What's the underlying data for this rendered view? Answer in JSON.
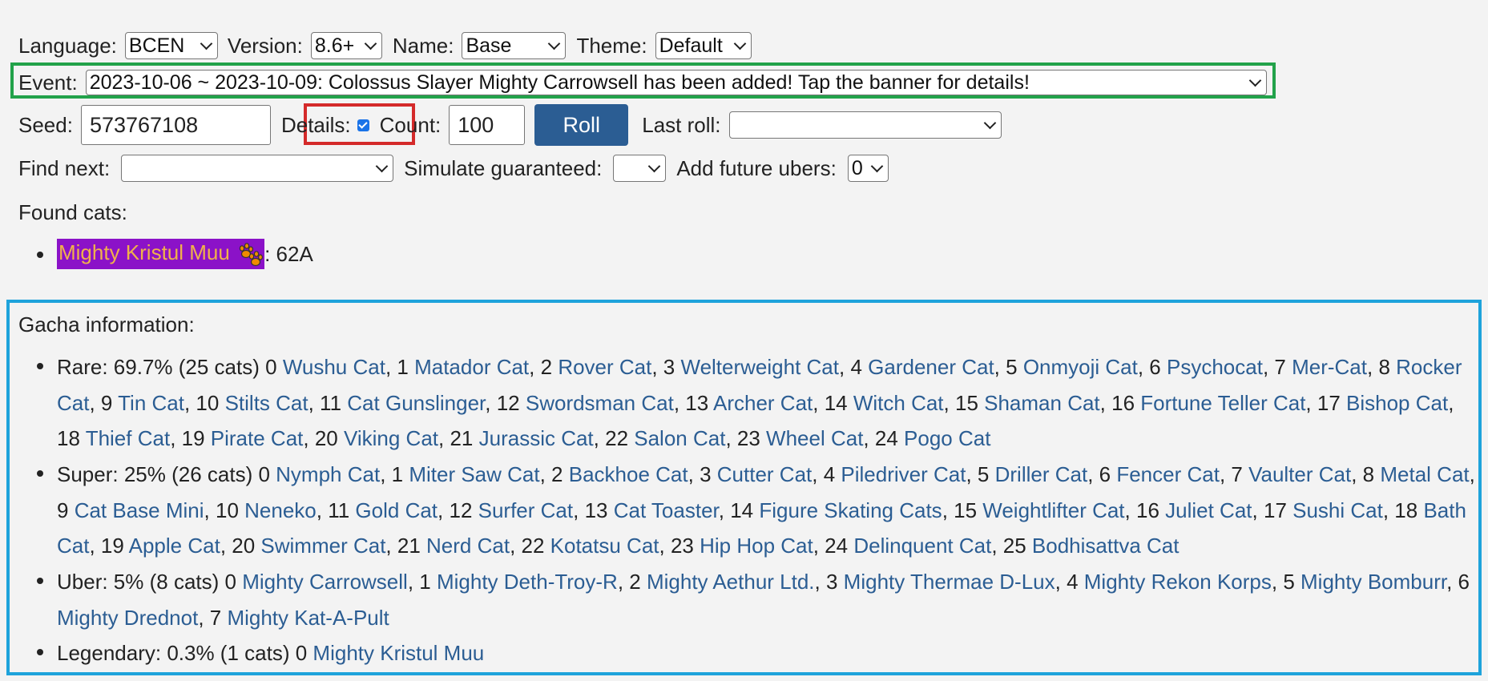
{
  "top": {
    "language_label": "Language:",
    "language_value": "BCEN",
    "version_label": "Version:",
    "version_value": "8.6+",
    "name_label": "Name:",
    "name_value": "Base",
    "theme_label": "Theme:",
    "theme_value": "Default"
  },
  "event": {
    "label": "Event:",
    "value": "2023-10-06 ~ 2023-10-09: Colossus Slayer Mighty Carrowsell has been added! Tap the banner for details!"
  },
  "seed_row": {
    "seed_label": "Seed:",
    "seed_value": "573767108",
    "details_label": "Details:",
    "count_label": "Count:",
    "count_value": "100",
    "roll_label": "Roll",
    "last_roll_label": "Last roll:",
    "last_roll_value": ""
  },
  "find_row": {
    "find_label": "Find next:",
    "find_value": "",
    "simulate_label": "Simulate guaranteed:",
    "simulate_value": "",
    "future_label": "Add future ubers:",
    "future_value": "0"
  },
  "found": {
    "heading": "Found cats:",
    "cat_name": "Mighty Kristul Muu",
    "cat_suffix": ": 62A"
  },
  "gacha": {
    "heading": "Gacha information:",
    "rare_prefix": "Rare: 69.7% (25 cats)",
    "rare_cats": [
      "Wushu Cat",
      "Matador Cat",
      "Rover Cat",
      "Welterweight Cat",
      "Gardener Cat",
      "Onmyoji Cat",
      "Psychocat",
      "Mer-Cat",
      "Rocker Cat",
      "Tin Cat",
      "Stilts Cat",
      "Cat Gunslinger",
      "Swordsman Cat",
      "Archer Cat",
      "Witch Cat",
      "Shaman Cat",
      "Fortune Teller Cat",
      "Bishop Cat",
      "Thief Cat",
      "Pirate Cat",
      "Viking Cat",
      "Jurassic Cat",
      "Salon Cat",
      "Wheel Cat",
      "Pogo Cat"
    ],
    "super_prefix": "Super: 25% (26 cats)",
    "super_cats": [
      "Nymph Cat",
      "Miter Saw Cat",
      "Backhoe Cat",
      "Cutter Cat",
      "Piledriver Cat",
      "Driller Cat",
      "Fencer Cat",
      "Vaulter Cat",
      "Metal Cat",
      "Cat Base Mini",
      "Neneko",
      "Gold Cat",
      "Surfer Cat",
      "Cat Toaster",
      "Figure Skating Cats",
      "Weightlifter Cat",
      "Juliet Cat",
      "Sushi Cat",
      "Bath Cat",
      "Apple Cat",
      "Swimmer Cat",
      "Nerd Cat",
      "Kotatsu Cat",
      "Hip Hop Cat",
      "Delinquent Cat",
      "Bodhisattva Cat"
    ],
    "uber_prefix": "Uber: 5% (8 cats)",
    "uber_cats": [
      "Mighty Carrowsell",
      "Mighty Deth-Troy-R",
      "Mighty Aethur Ltd.",
      "Mighty Thermae D-Lux",
      "Mighty Rekon Korps",
      "Mighty Bomburr",
      "Mighty Drednot",
      "Mighty Kat-A-Pult"
    ],
    "legend_prefix": "Legendary: 0.3% (1 cats)",
    "legend_cats": [
      "Mighty Kristul Muu"
    ]
  },
  "colors": {
    "link": "#2b5d93",
    "roll_button": "#2b5d93",
    "event_box": "#22a24a",
    "details_box": "#d42a2a",
    "gacha_box": "#1ea3db",
    "highlight_bg": "#8b12c8",
    "highlight_text": "#f0b24a"
  }
}
